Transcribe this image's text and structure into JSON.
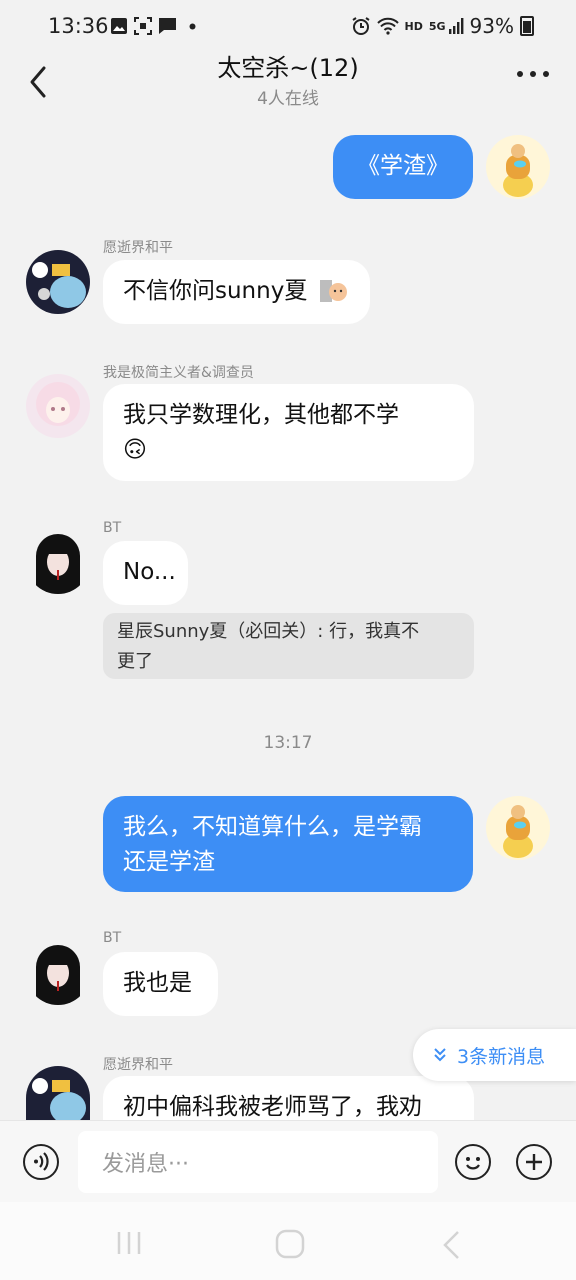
{
  "status_bar": {
    "time": "13:36",
    "hd": "HD",
    "net": "5G",
    "battery": "93%"
  },
  "header": {
    "title": "太空杀~(12)",
    "subtitle": "4人在线"
  },
  "messages": [
    {
      "text": "《学渣》"
    },
    {
      "sender": "愿逝界和平",
      "text": "不信你问sunny夏"
    },
    {
      "sender": "我是极简主义者&调查员",
      "line1": "我只学数理化，其他都不学",
      "emoji": "🙃"
    },
    {
      "sender": "BT",
      "text": "No..."
    },
    {
      "quote_line1": "星辰Sunny夏（必回关）: 行，我真不",
      "quote_line2": "更了"
    },
    {
      "timestamp": "13:17"
    },
    {
      "line1": "我么，不知道算什么，是学霸",
      "line2": "还是学渣"
    },
    {
      "sender": "BT",
      "text": "我也是"
    },
    {
      "sender": "愿逝界和平",
      "text": "初中偏科我被老师骂了，我劝"
    }
  ],
  "new_messages": "3条新消息",
  "input": {
    "placeholder": "发消息···"
  },
  "icons": [
    "back-icon",
    "more-icon",
    "voice-icon",
    "emoji-icon",
    "plus-icon",
    "chevron-double-down-icon",
    "recents-icon",
    "home-icon",
    "system-back-icon"
  ],
  "colors": {
    "accent": "#3d8ef5",
    "background": "#f2f2f2"
  }
}
